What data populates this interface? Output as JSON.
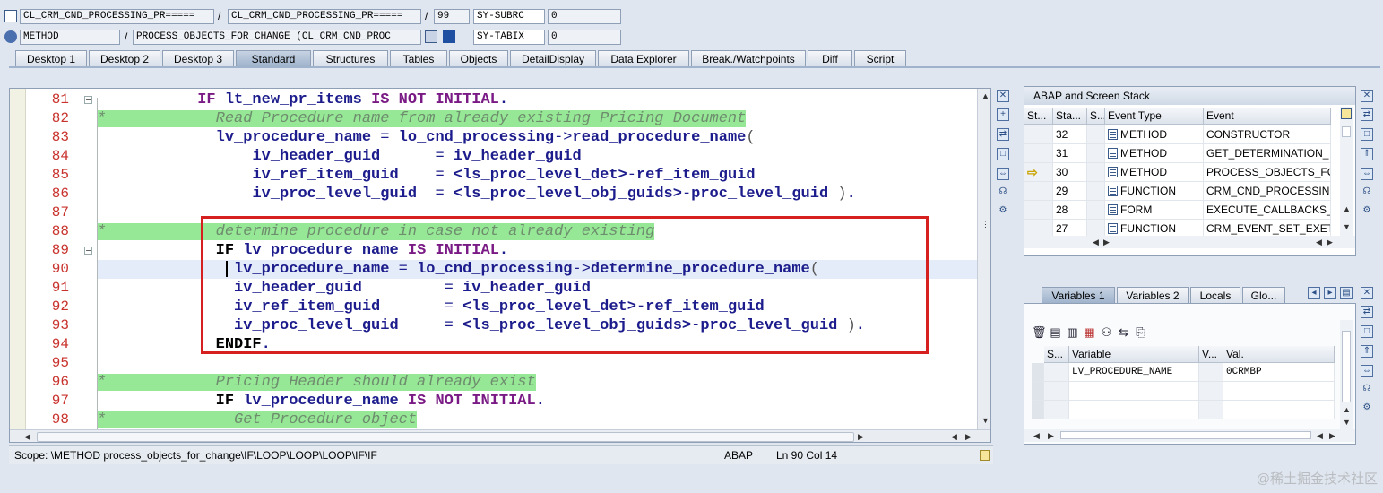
{
  "header": {
    "row1": {
      "program": "CL_CRM_CND_PROCESSING_PR=====",
      "include": "CL_CRM_CND_PROCESSING_PR=====",
      "line": "99",
      "sysvar": "SY-SUBRC",
      "sysval": "0"
    },
    "row2": {
      "type": "METHOD",
      "event": "PROCESS_OBJECTS_FOR_CHANGE (CL_CRM_CND_PROC",
      "sysvar": "SY-TABIX",
      "sysval": "0"
    },
    "slash": "/"
  },
  "tabs": [
    "Desktop 1",
    "Desktop 2",
    "Desktop 3",
    "Standard",
    "Structures",
    "Tables",
    "Objects",
    "DetailDisplay",
    "Data Explorer",
    "Break./Watchpoints",
    "Diff",
    "Script"
  ],
  "active_tab": "Standard",
  "editor": {
    "lines": [
      {
        "num": "81",
        "fold": true,
        "tokens": [
          [
            "pad",
            "           "
          ],
          [
            "kw",
            "IF"
          ],
          [
            "pad",
            " "
          ],
          [
            "id",
            "lt_new_pr_items"
          ],
          [
            "pad",
            " "
          ],
          [
            "kw",
            "IS NOT INITIAL"
          ],
          [
            "id",
            "."
          ]
        ]
      },
      {
        "num": "82",
        "comment": true,
        "tokens": [
          [
            "comment",
            "*            Read Procedure name from already existing Pricing Document"
          ]
        ]
      },
      {
        "num": "83",
        "tokens": [
          [
            "pad",
            "             "
          ],
          [
            "id",
            "lv_procedure_name"
          ],
          [
            "op",
            " = "
          ],
          [
            "id",
            "lo_cnd_processing"
          ],
          [
            "op",
            "->"
          ],
          [
            "fn",
            "read_procedure_name"
          ],
          [
            "par",
            "("
          ]
        ]
      },
      {
        "num": "84",
        "tokens": [
          [
            "pad",
            "                 "
          ],
          [
            "id",
            "iv_header_guid"
          ],
          [
            "op",
            "      = "
          ],
          [
            "id",
            "iv_header_guid"
          ]
        ]
      },
      {
        "num": "85",
        "tokens": [
          [
            "pad",
            "                 "
          ],
          [
            "id",
            "iv_ref_item_guid"
          ],
          [
            "op",
            "    = "
          ],
          [
            "id",
            "<ls_proc_level_det>"
          ],
          [
            "op",
            "-"
          ],
          [
            "id",
            "ref_item_guid"
          ]
        ]
      },
      {
        "num": "86",
        "tokens": [
          [
            "pad",
            "                 "
          ],
          [
            "id",
            "iv_proc_level_guid"
          ],
          [
            "op",
            "  = "
          ],
          [
            "id",
            "<ls_proc_level_obj_guids>"
          ],
          [
            "op",
            "-"
          ],
          [
            "id",
            "proc_level_guid"
          ],
          [
            "par",
            " )"
          ],
          [
            "id",
            "."
          ]
        ]
      },
      {
        "num": "87",
        "tokens": []
      },
      {
        "num": "88",
        "comment": true,
        "tokens": [
          [
            "comment",
            "*            determine procedure in case not already existing"
          ]
        ]
      },
      {
        "num": "89",
        "fold": true,
        "tokens": [
          [
            "pad",
            "             "
          ],
          [
            "kwk",
            "IF"
          ],
          [
            "pad",
            " "
          ],
          [
            "id",
            "lv_procedure_name"
          ],
          [
            "pad",
            " "
          ],
          [
            "kw",
            "IS INITIAL"
          ],
          [
            "id",
            "."
          ]
        ]
      },
      {
        "num": "90",
        "current": true,
        "tokens": [
          [
            "pad",
            "               "
          ],
          [
            "id",
            "lv_procedure_name"
          ],
          [
            "op",
            " = "
          ],
          [
            "id",
            "lo_cnd_processing"
          ],
          [
            "op",
            "->"
          ],
          [
            "fn",
            "determine_procedure_name"
          ],
          [
            "par",
            "("
          ]
        ]
      },
      {
        "num": "91",
        "tokens": [
          [
            "pad",
            "               "
          ],
          [
            "id",
            "iv_header_guid"
          ],
          [
            "op",
            "         = "
          ],
          [
            "id",
            "iv_header_guid"
          ]
        ]
      },
      {
        "num": "92",
        "tokens": [
          [
            "pad",
            "               "
          ],
          [
            "id",
            "iv_ref_item_guid"
          ],
          [
            "op",
            "       = "
          ],
          [
            "id",
            "<ls_proc_level_det>"
          ],
          [
            "op",
            "-"
          ],
          [
            "id",
            "ref_item_guid"
          ]
        ]
      },
      {
        "num": "93",
        "tokens": [
          [
            "pad",
            "               "
          ],
          [
            "id",
            "iv_proc_level_guid"
          ],
          [
            "op",
            "     = "
          ],
          [
            "id",
            "<ls_proc_level_obj_guids>"
          ],
          [
            "op",
            "-"
          ],
          [
            "id",
            "proc_level_guid"
          ],
          [
            "par",
            " )"
          ],
          [
            "id",
            "."
          ]
        ]
      },
      {
        "num": "94",
        "tokens": [
          [
            "pad",
            "             "
          ],
          [
            "kwk",
            "ENDIF"
          ],
          [
            "id",
            "."
          ]
        ]
      },
      {
        "num": "95",
        "tokens": []
      },
      {
        "num": "96",
        "comment": true,
        "tokens": [
          [
            "comment",
            "*            Pricing Header should already exist"
          ]
        ]
      },
      {
        "num": "97",
        "tokens": [
          [
            "pad",
            "             "
          ],
          [
            "kwk",
            "IF"
          ],
          [
            "pad",
            " "
          ],
          [
            "id",
            "lv_procedure_name"
          ],
          [
            "pad",
            " "
          ],
          [
            "kw",
            "IS NOT INITIAL"
          ],
          [
            "id",
            "."
          ]
        ]
      },
      {
        "num": "98",
        "comment": true,
        "tokens": [
          [
            "comment",
            "*              Get Procedure object"
          ]
        ]
      }
    ]
  },
  "status": {
    "scope": "Scope: \\METHOD process_objects_for_change\\IF\\LOOP\\LOOP\\LOOP\\IF\\IF",
    "lang": "ABAP",
    "pos": "Ln  90 Col  14"
  },
  "stack": {
    "title": "ABAP and Screen Stack",
    "columns": [
      "St...",
      "Sta...",
      "S...",
      "Event Type",
      "Event"
    ],
    "rows": [
      {
        "level": "32",
        "type": "METHOD",
        "event": "CONSTRUCTOR",
        "current": false
      },
      {
        "level": "31",
        "type": "METHOD",
        "event": "GET_DETERMINATION_",
        "current": false
      },
      {
        "level": "30",
        "type": "METHOD",
        "event": "PROCESS_OBJECTS_FOR_",
        "current": true
      },
      {
        "level": "29",
        "type": "FUNCTION",
        "event": "CRM_CND_PROCESSING_",
        "current": false
      },
      {
        "level": "28",
        "type": "FORM",
        "event": "EXECUTE_CALLBACKS_P_",
        "current": false
      },
      {
        "level": "27",
        "type": "FUNCTION",
        "event": "CRM_EVENT_SET_EXETI_",
        "current": false
      }
    ]
  },
  "variables": {
    "tabs": [
      "Variables 1",
      "Variables 2",
      "Locals",
      "Glo..."
    ],
    "columns": [
      "S...",
      "Variable",
      "V...",
      "Val."
    ],
    "rows": [
      {
        "variable": "LV_PROCEDURE_NAME",
        "value": "0CRMBP"
      }
    ]
  },
  "watermark": "@稀土掘金技术社区",
  "colors": {
    "background": "#dfe6ef",
    "comment_bg": "#96e896",
    "line_numbers": "#c8322c",
    "highlight_box": "#d62020"
  }
}
